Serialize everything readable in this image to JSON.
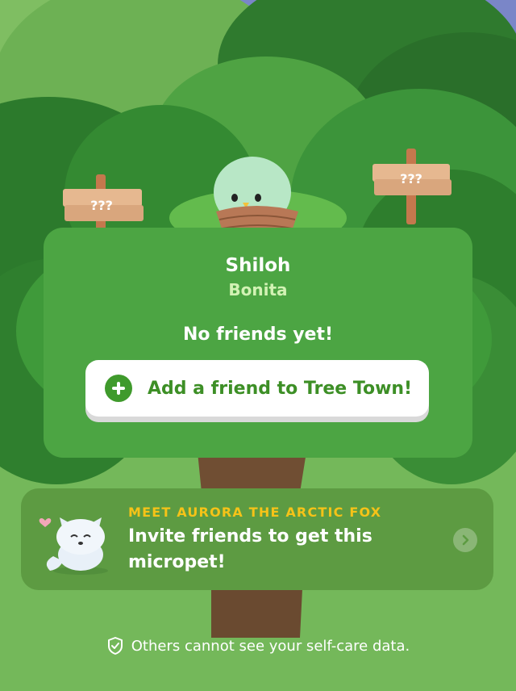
{
  "scene": {
    "signs": [
      {
        "text": "???"
      },
      {
        "text": "???"
      }
    ]
  },
  "pet": {
    "name": "Shiloh",
    "species": "Bonita"
  },
  "friends": {
    "empty_message": "No friends yet!",
    "add_button_label": "Add a friend to Tree Town!"
  },
  "promo": {
    "title": "MEET AURORA THE ARCTIC FOX",
    "body": "Invite friends to get this micropet!"
  },
  "footer": {
    "privacy_note": "Others cannot see your self-care data."
  },
  "colors": {
    "sky": "#7a86c8",
    "card": "#4ca543",
    "accent_green": "#3f9a2c",
    "promo_title": "#f5c318"
  }
}
